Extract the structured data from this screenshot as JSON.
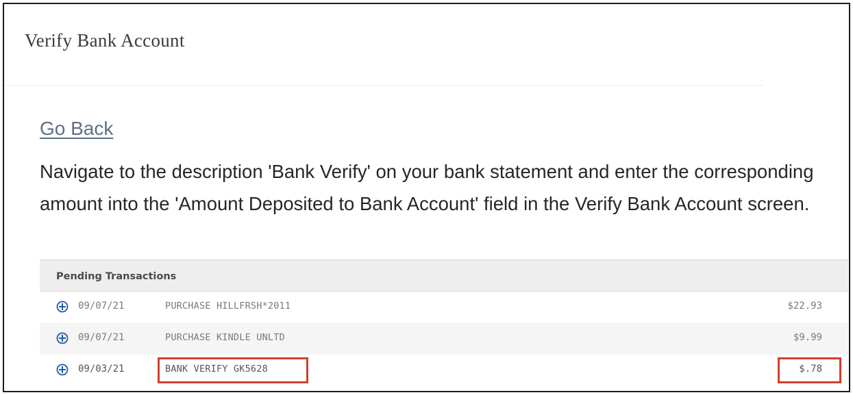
{
  "header": {
    "title": "Verify Bank Account"
  },
  "content": {
    "go_back_label": "Go Back",
    "instructions": "Navigate to the description 'Bank Verify' on your bank statement and enter the corresponding amount into the 'Amount Deposited to Bank Account' field in the Verify Bank Account screen."
  },
  "transactions": {
    "header_label": "Pending Transactions",
    "rows": [
      {
        "date": "09/07/21",
        "description": "PURCHASE HILLFRSH*2011",
        "amount": "$22.93"
      },
      {
        "date": "09/07/21",
        "description": "PURCHASE KINDLE UNLTD",
        "amount": "$9.99"
      },
      {
        "date": "09/03/21",
        "description": "BANK VERIFY GK5628",
        "amount": "$.78"
      }
    ]
  },
  "colors": {
    "link": "#5e6f86",
    "highlight_border": "#d0402c",
    "plus_icon": "#1f5aa8",
    "header_bg": "#eeeeee"
  },
  "icons": {
    "expand_row": "plus-circle-icon"
  }
}
